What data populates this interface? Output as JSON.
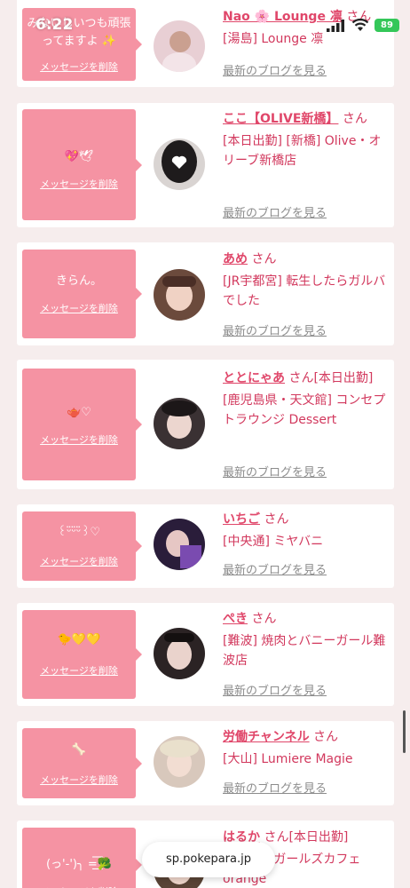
{
  "status": {
    "time": "6:22",
    "battery": "89"
  },
  "common": {
    "delete_label": "メッセージを削除",
    "blog_label": "最新のブログを見る",
    "san": "さん"
  },
  "cards": [
    {
      "message": "みないしいつも頑張ってますよ ✨",
      "name": "Nao 🌸 Lounge 凛",
      "san_extra": "",
      "shop": "[湯島] Lounge 凛"
    },
    {
      "message": "💖🕊",
      "name": "ここ【OLIVE新橋】",
      "san_extra": "",
      "shop": "[本日出勤] [新橋] Olive・オリーブ新橋店"
    },
    {
      "message": "きらん。",
      "name": "あめ",
      "san_extra": "",
      "shop": "[JR宇都宮] 転生したらガルバでした"
    },
    {
      "message": "🫖♡",
      "name": "ととにゃあ",
      "san_extra": "[本日出勤]",
      "shop": "[鹿児島県・天文館] コンセプトラウンジ Dessert"
    },
    {
      "message": "꒰ᵕ̈ᵕ̈ᵕ̈꒱♡",
      "name": "いちご",
      "san_extra": "",
      "shop": "[中央通] ミヤバニ"
    },
    {
      "message": "🐤💛💛",
      "name": "ぺき",
      "san_extra": "",
      "shop": "[難波] 焼肉とバニーガール難波店"
    },
    {
      "message": "🦴",
      "name": "労働チャンネル",
      "san_extra": "",
      "shop": "[大山] Lumiere Magie"
    },
    {
      "message": "(っ'-')╮ =͟͟͞͞🥦",
      "name": "はるか",
      "san_extra": "[本日出勤]",
      "shop": "[宇都宮] ガールズカフェ orange"
    }
  ],
  "browser": {
    "url": "sp.pokepara.jp"
  },
  "colors": {
    "accent": "#e0476a",
    "bubble": "#f593a3",
    "background": "#f6eded"
  }
}
